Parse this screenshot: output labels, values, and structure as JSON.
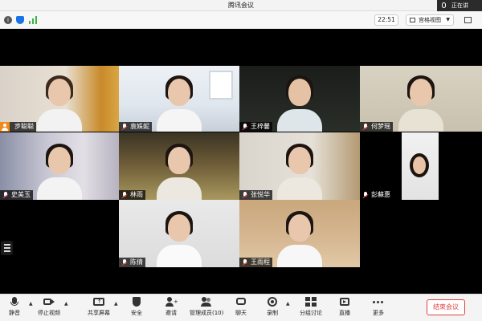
{
  "app": {
    "title": "腾讯会议"
  },
  "speaking": {
    "label": "正在讲"
  },
  "infobar": {
    "timer": "22:51",
    "view_label": "宫格视图"
  },
  "participants": [
    {
      "name": "步聪聪",
      "host": true
    },
    {
      "name": "袁姝妮"
    },
    {
      "name": "王梓馨"
    },
    {
      "name": "何梦瑶"
    },
    {
      "name": "史美玉"
    },
    {
      "name": "林雨"
    },
    {
      "name": "张悦华"
    },
    {
      "name": "彭蘇惠"
    },
    {
      "name": "陈倩"
    },
    {
      "name": "王雨程"
    }
  ],
  "toolbar": {
    "mute": "静音",
    "stop_video": "停止视频",
    "share": "共享屏幕",
    "security": "安全",
    "invite": "邀请",
    "manage": "管理成员(10)",
    "chat": "聊天",
    "record": "录制",
    "breakout": "分组讨论",
    "live": "直播",
    "more": "更多",
    "end": "结束会议"
  },
  "colors": {
    "accent": "#1a73e8",
    "end_red": "#e04040",
    "host_orange": "#f08a1c"
  }
}
